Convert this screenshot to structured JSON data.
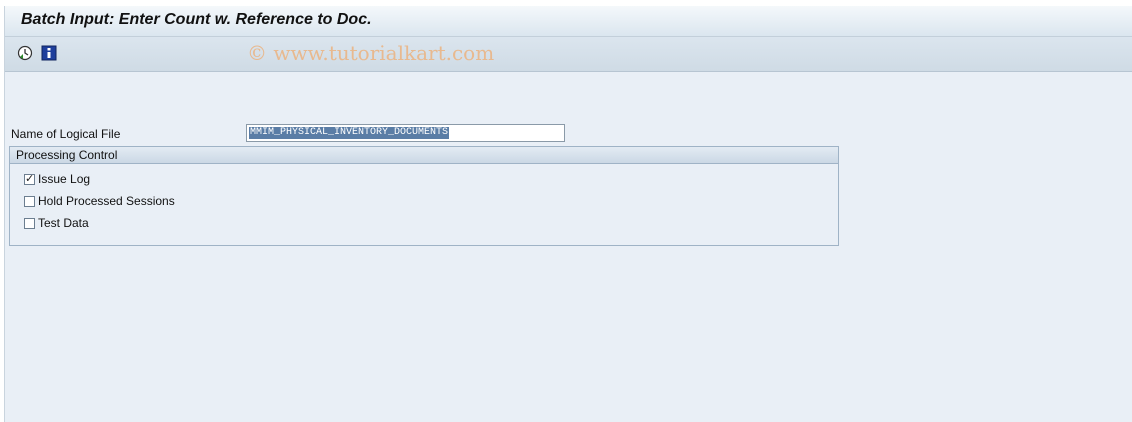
{
  "window": {
    "title": "Batch Input: Enter Count w. Reference to Doc."
  },
  "toolbar": {
    "execute_icon": "execute-clock-icon",
    "info_icon": "information-icon",
    "watermark": "© www.tutorialkart.com"
  },
  "form": {
    "logical_file_label": "Name of Logical File",
    "logical_file_value": "MMIM_PHYSICAL_INVENTORY_DOCUMENTS"
  },
  "processing_control": {
    "title": "Processing Control",
    "options": [
      {
        "label": "Issue Log",
        "checked": true
      },
      {
        "label": "Hold Processed Sessions",
        "checked": false
      },
      {
        "label": "Test Data",
        "checked": false
      }
    ]
  },
  "colors": {
    "background": "#e9eff6",
    "selection": "#5a7da6",
    "watermark": "#e8b98f"
  }
}
